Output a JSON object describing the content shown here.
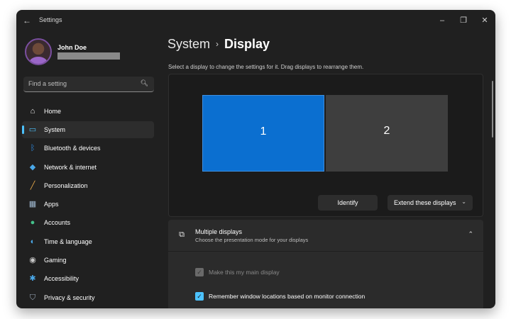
{
  "window": {
    "title": "Settings"
  },
  "user": {
    "name": "John Doe"
  },
  "search": {
    "placeholder": "Find a setting"
  },
  "sidebar": {
    "items": [
      {
        "label": "Home",
        "icon": "home-icon",
        "color": "#f0f0f0"
      },
      {
        "label": "System",
        "icon": "system-icon",
        "color": "#4cc2ff",
        "active": true
      },
      {
        "label": "Bluetooth & devices",
        "icon": "bluetooth-icon",
        "color": "#2f8fe8"
      },
      {
        "label": "Network & internet",
        "icon": "wifi-icon",
        "color": "#4aa8e8"
      },
      {
        "label": "Personalization",
        "icon": "brush-icon",
        "color": "#e6a84a"
      },
      {
        "label": "Apps",
        "icon": "apps-icon",
        "color": "#9fb8d0"
      },
      {
        "label": "Accounts",
        "icon": "accounts-icon",
        "color": "#44c08a"
      },
      {
        "label": "Time & language",
        "icon": "globe-icon",
        "color": "#4aa8e8"
      },
      {
        "label": "Gaming",
        "icon": "gaming-icon",
        "color": "#c8c8c8"
      },
      {
        "label": "Accessibility",
        "icon": "accessibility-icon",
        "color": "#4aa8e8"
      },
      {
        "label": "Privacy & security",
        "icon": "shield-icon",
        "color": "#9aa8b8"
      }
    ]
  },
  "header": {
    "breadcrumb_root": "System",
    "breadcrumb_sep": "›",
    "breadcrumb_leaf": "Display"
  },
  "main": {
    "subtitle": "Select a display to change the settings for it. Drag displays to rearrange them.",
    "monitors": [
      {
        "label": "1",
        "selected": true
      },
      {
        "label": "2",
        "selected": false
      }
    ],
    "identify_label": "Identify",
    "extend_label": "Extend these displays",
    "multi": {
      "title": "Multiple displays",
      "description": "Choose the presentation mode for your displays",
      "options": [
        {
          "label": "Make this my main display",
          "checked": true,
          "disabled": true
        },
        {
          "label": "Remember window locations based on monitor connection",
          "checked": true,
          "disabled": false
        }
      ]
    }
  },
  "colors": {
    "accent": "#4cc2ff",
    "selected_monitor": "#0b6fd0",
    "background": "#202020"
  }
}
